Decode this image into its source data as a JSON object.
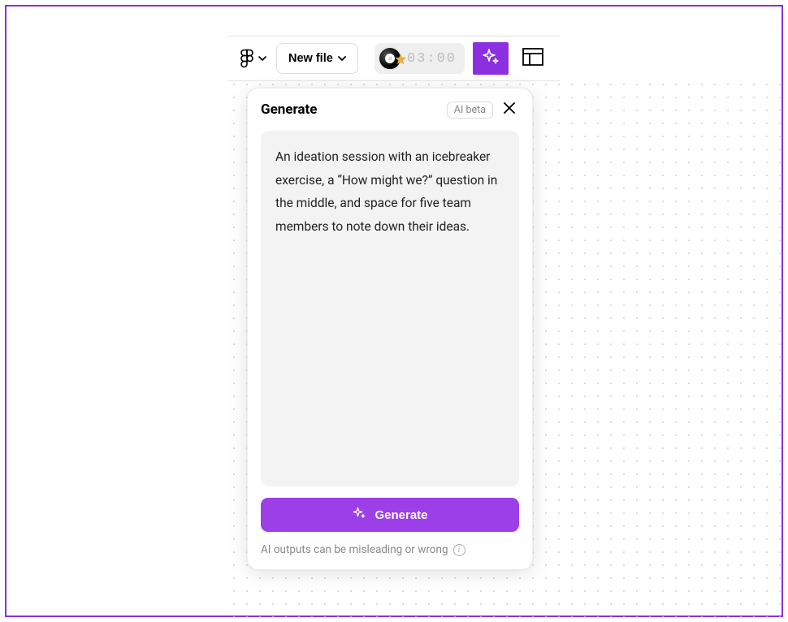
{
  "toolbar": {
    "new_file_label": "New file",
    "timer_text": "03:00"
  },
  "panel": {
    "title": "Generate",
    "badge": "AI beta",
    "prompt_text": "An ideation session with an icebreaker exercise, a “How might we?” question in the middle, and space for five team members to note down their ideas.",
    "generate_button_label": "Generate",
    "disclaimer": "AI outputs can be misleading or wrong"
  },
  "colors": {
    "accent": "#8b2fe0"
  }
}
